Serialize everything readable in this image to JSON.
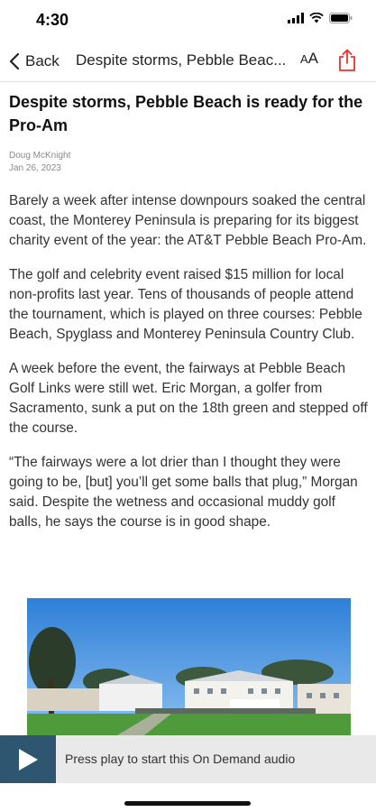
{
  "status_bar": {
    "time": "4:30",
    "icons": [
      "signal-icon",
      "wifi-icon",
      "battery-icon"
    ]
  },
  "nav": {
    "back_label": "Back",
    "title": "Despite storms, Pebble Beac...",
    "text_size_small": "A",
    "text_size_large": "A",
    "share_icon": "share-icon",
    "accent_color": "#e8322e"
  },
  "article": {
    "headline": "Despite storms, Pebble Beach is ready for the Pro-Am",
    "author": "Doug McKnight",
    "date": "Jan 26, 2023",
    "paragraphs": [
      "Barely a week after intense downpours soaked the central coast, the Monterey Peninsula is preparing for its biggest charity event of the year: the AT&T Pebble Beach Pro-Am.",
      "The golf and celebrity event raised $15 million for local non-profits last year. Tens of thousands of people attend the tournament, which is played on three courses: Pebble Beach, Spyglass and Monterey Peninsula Country Club.",
      "A week before the event, the fairways at Pebble Beach Golf Links were still wet. Eric Morgan, a golfer from Sacramento, sunk a put on the 18th green and stepped off the course.",
      "“The fairways were a lot drier than I thought they were going to be, [but] you’ll get some balls that plug,” Morgan said. Despite the wetness and occasional muddy golf balls, he says the course is in good shape."
    ]
  },
  "audio": {
    "prompt": "Press play to start this On Demand audio",
    "play_icon": "play-icon",
    "button_color": "#2f5670"
  }
}
